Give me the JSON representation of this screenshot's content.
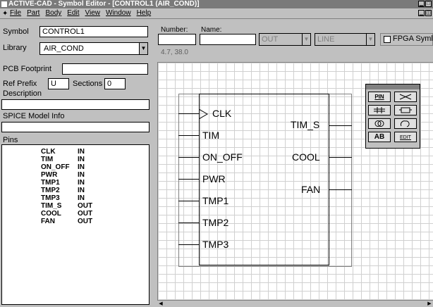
{
  "window": {
    "title": "ACTIVE-CAD - Symbol Editor - [CONTROL1 (AIR_COND)]"
  },
  "menu": {
    "items": [
      "File",
      "Part",
      "Body",
      "Edit",
      "View",
      "Window",
      "Help"
    ]
  },
  "props": {
    "symbol_label": "Symbol",
    "symbol_value": "CONTROL1",
    "library_label": "Library",
    "library_value": "AIR_COND",
    "pcb_label": "PCB Footprint",
    "pcb_value": "",
    "ref_prefix_label": "Ref Prefix",
    "ref_prefix_value": "U",
    "sections_label": "Sections",
    "sections_value": "0",
    "description_label": "Description",
    "description_value": "",
    "spice_label": "SPICE Model Info",
    "spice_value": "",
    "pins_label": "Pins"
  },
  "pins_list": [
    {
      "name": "CLK",
      "dir": "IN"
    },
    {
      "name": "TIM",
      "dir": "IN"
    },
    {
      "name": "ON_OFF",
      "dir": "IN"
    },
    {
      "name": "PWR",
      "dir": "IN"
    },
    {
      "name": "TMP1",
      "dir": "IN"
    },
    {
      "name": "TMP2",
      "dir": "IN"
    },
    {
      "name": "TMP3",
      "dir": "IN"
    },
    {
      "name": "TIM_S",
      "dir": "OUT"
    },
    {
      "name": "COOL",
      "dir": "OUT"
    },
    {
      "name": "FAN",
      "dir": "OUT"
    }
  ],
  "pin_editor": {
    "number_label": "Number:",
    "number_value": "",
    "name_label": "Name:",
    "name_value": "",
    "type_value": "OUT",
    "shape_value": "LINE",
    "fpga_label": "FPGA Syml",
    "coords": "4.7, 38.0"
  },
  "symbol": {
    "left_pins": [
      "CLK",
      "TIM",
      "ON_OFF",
      "PWR",
      "TMP1",
      "TMP2",
      "TMP3"
    ],
    "right_pins": [
      "TIM_S",
      "COOL",
      "FAN"
    ]
  },
  "palette": {
    "tools": [
      "PIN",
      "X",
      "BUS",
      "RECT",
      "CIRCLE",
      "ARC",
      "TEXT",
      "EDIT"
    ],
    "pin_label": "PIN",
    "text_label": "AB",
    "edit_label": "EDIT"
  }
}
